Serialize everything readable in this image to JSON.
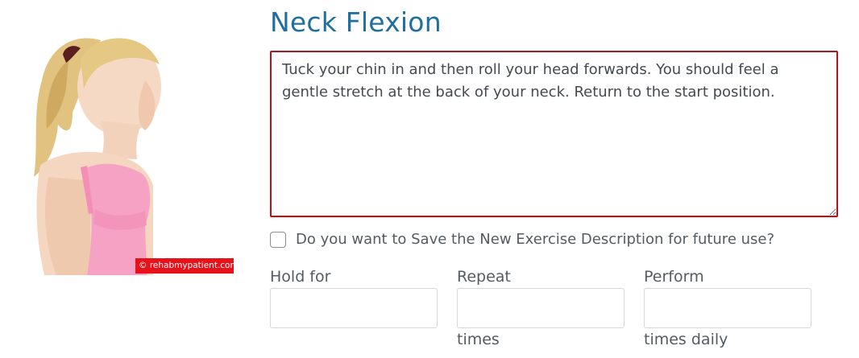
{
  "exercise": {
    "title": "Neck Flexion",
    "description": "Tuck your chin in and then roll your head forwards. You should feel a gentle stretch at the back of your neck. Return to the start position.",
    "watermark": "© rehabmypatient.com"
  },
  "save_option": {
    "label": "Do you want to Save the New Exercise Description for future use?",
    "checked": false
  },
  "fields": {
    "hold": {
      "label": "Hold for",
      "value": "",
      "unit": ""
    },
    "repeat": {
      "label": "Repeat",
      "value": "",
      "unit": "times"
    },
    "perform": {
      "label": "Perform",
      "value": "",
      "unit": "times daily"
    }
  },
  "colors": {
    "title": "#1e6f9f",
    "description_border": "#a31a1f",
    "watermark_bg": "#e8111a",
    "text": "#555b61"
  }
}
